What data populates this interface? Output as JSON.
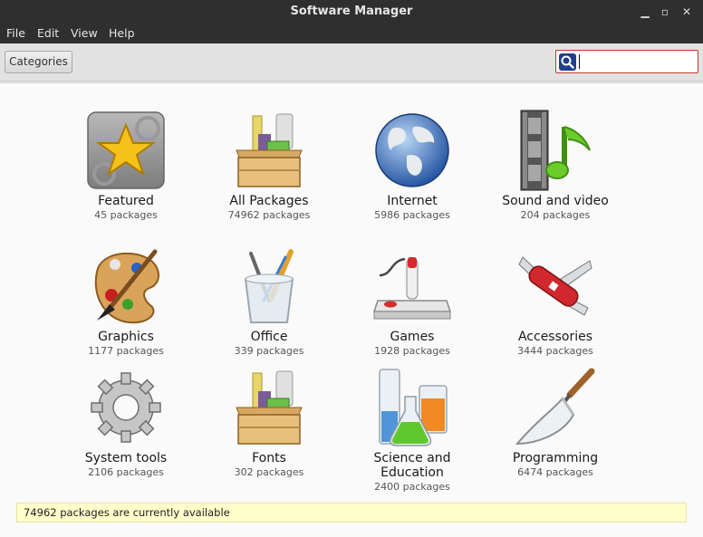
{
  "window": {
    "title": "Software Manager",
    "minimize_glyph": "▁",
    "maximize_glyph": "▫",
    "close_glyph": "✕"
  },
  "menu": {
    "file": "File",
    "edit": "Edit",
    "view": "View",
    "help": "Help"
  },
  "toolbar": {
    "categories_label": "Categories",
    "search_value": "",
    "search_border_color": "#c0392b"
  },
  "categories": [
    {
      "name": "Featured",
      "count": "45 packages",
      "icon": "featured-star-icon"
    },
    {
      "name": "All Packages",
      "count": "74962 packages",
      "icon": "package-box-icon"
    },
    {
      "name": "Internet",
      "count": "5986 packages",
      "icon": "globe-icon"
    },
    {
      "name": "Sound and video",
      "count": "204 packages",
      "icon": "film-music-icon"
    },
    {
      "name": "Graphics",
      "count": "1177 packages",
      "icon": "paint-palette-icon"
    },
    {
      "name": "Office",
      "count": "339 packages",
      "icon": "pencil-cup-icon"
    },
    {
      "name": "Games",
      "count": "1928 packages",
      "icon": "joystick-icon"
    },
    {
      "name": "Accessories",
      "count": "3444 packages",
      "icon": "swiss-knife-icon"
    },
    {
      "name": "System tools",
      "count": "2106 packages",
      "icon": "gear-icon"
    },
    {
      "name": "Fonts",
      "count": "302 packages",
      "icon": "package-box-icon"
    },
    {
      "name": "Science and Education",
      "count": "2400 packages",
      "icon": "lab-flasks-icon"
    },
    {
      "name": "Programming",
      "count": "6474 packages",
      "icon": "trowel-icon"
    }
  ],
  "status": {
    "message": "74962 packages are currently available"
  }
}
